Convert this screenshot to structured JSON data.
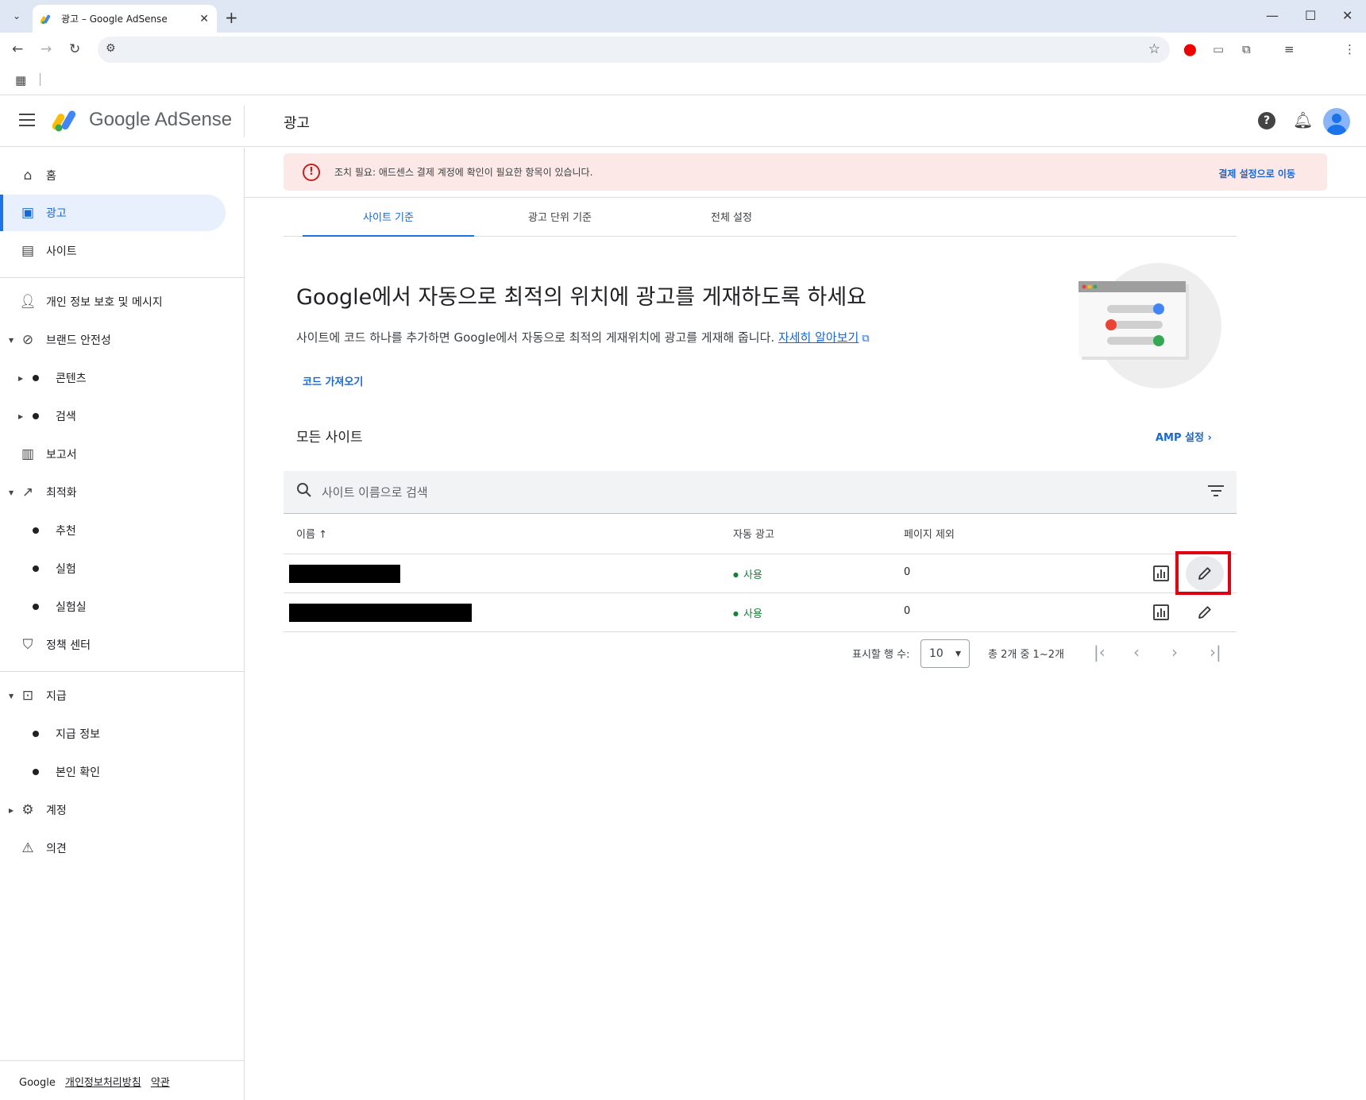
{
  "browser": {
    "tab_title": "광고 – Google AdSense",
    "new_tab_label": "+",
    "tab_close_label": "✕"
  },
  "app": {
    "logo_text": "Google AdSense",
    "page_title": "광고"
  },
  "sidebar": {
    "items": [
      {
        "label": "홈",
        "icon": "home-icon"
      },
      {
        "label": "광고",
        "icon": "ads-icon",
        "active": true
      },
      {
        "label": "사이트",
        "icon": "sites-icon"
      },
      {
        "label": "개인 정보 보호 및 메시지",
        "icon": "privacy-icon"
      },
      {
        "label": "브랜드 안전성",
        "icon": "block-icon"
      },
      {
        "label": "콘텐츠"
      },
      {
        "label": "검색"
      },
      {
        "label": "보고서",
        "icon": "reports-icon"
      },
      {
        "label": "최적화",
        "icon": "trend-icon"
      },
      {
        "label": "추천"
      },
      {
        "label": "실험"
      },
      {
        "label": "실험실"
      },
      {
        "label": "정책 센터",
        "icon": "policy-icon"
      },
      {
        "label": "지급",
        "icon": "payments-icon"
      },
      {
        "label": "지급 정보"
      },
      {
        "label": "본인 확인"
      },
      {
        "label": "계정",
        "icon": "gear-icon"
      },
      {
        "label": "의견",
        "icon": "feedback-icon"
      }
    ],
    "footer": {
      "brand": "Google",
      "privacy": "개인정보처리방침",
      "terms": "약관"
    }
  },
  "alert": {
    "text": "조치 필요: 애드센스 결제 계정에 확인이 필요한 항목이 있습니다.",
    "action": "결제 설정으로 이동",
    "color": "#fce8e6"
  },
  "tabs": [
    {
      "label": "사이트 기준",
      "active": true
    },
    {
      "label": "광고 단위 기준"
    },
    {
      "label": "전체 설정"
    }
  ],
  "hero": {
    "title": "Google에서 자동으로 최적의 위치에 광고를 게재하도록 하세요",
    "description": "사이트에 코드 하나를 추가하면 Google에서 자동으로 최적의 게재위치에 광고를 게재해 줍니다.",
    "learn_more": "자세히 알아보기",
    "get_code": "코드 가져오기"
  },
  "sites": {
    "title": "모든 사이트",
    "amp_link": "AMP 설정",
    "search_placeholder": "사이트 이름으로 검색",
    "columns": {
      "name": "이름",
      "auto_ads": "자동 광고",
      "excluded": "페이지 제외"
    },
    "rows": [
      {
        "name": "",
        "auto_ads": "사용",
        "excluded": "0"
      },
      {
        "name": "",
        "auto_ads": "사용",
        "excluded": "0"
      }
    ]
  },
  "pagination": {
    "rows_label": "표시할 행 수:",
    "rows_value": "10",
    "range": "총 2개 중 1~2개"
  },
  "colors": {
    "accent": "#1a73e8",
    "status_green": "#188038",
    "highlight": "#e00012"
  }
}
